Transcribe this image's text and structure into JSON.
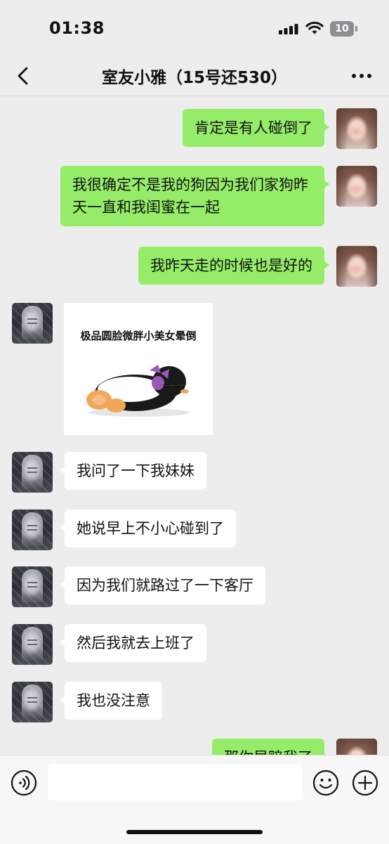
{
  "status_bar": {
    "time": "01:38",
    "battery_level": "10"
  },
  "nav": {
    "title": "室友小雅（15号还530）",
    "back_icon": "chevron-left-icon",
    "more_icon": "ellipsis-icon"
  },
  "messages": [
    {
      "sender": "me",
      "text": "肯定是有人碰倒了"
    },
    {
      "sender": "me",
      "text": "我很确定不是我的狗因为我们家狗昨天一直和我闺蜜在一起"
    },
    {
      "sender": "me",
      "text": "我昨天走的时候也是好的"
    },
    {
      "sender": "other",
      "type": "sticker",
      "caption": "极品圆脸微胖小美女晕倒",
      "icon": "fainted-penguin-sticker"
    },
    {
      "sender": "other",
      "text": "我问了一下我妹妹"
    },
    {
      "sender": "other",
      "text": "她说早上不小心碰到了"
    },
    {
      "sender": "other",
      "text": "因为我们就路过了一下客厅"
    },
    {
      "sender": "other",
      "text": "然后我就去上班了"
    },
    {
      "sender": "other",
      "text": "我也没注意"
    },
    {
      "sender": "me",
      "text": "那你早赔我了",
      "partially_visible": true
    }
  ],
  "input_bar": {
    "placeholder": "",
    "voice_icon": "voice-icon",
    "emoji_icon": "emoji-icon",
    "plus_icon": "plus-icon"
  },
  "colors": {
    "background": "#ededed",
    "my_bubble": "#95ec69",
    "their_bubble": "#ffffff"
  }
}
